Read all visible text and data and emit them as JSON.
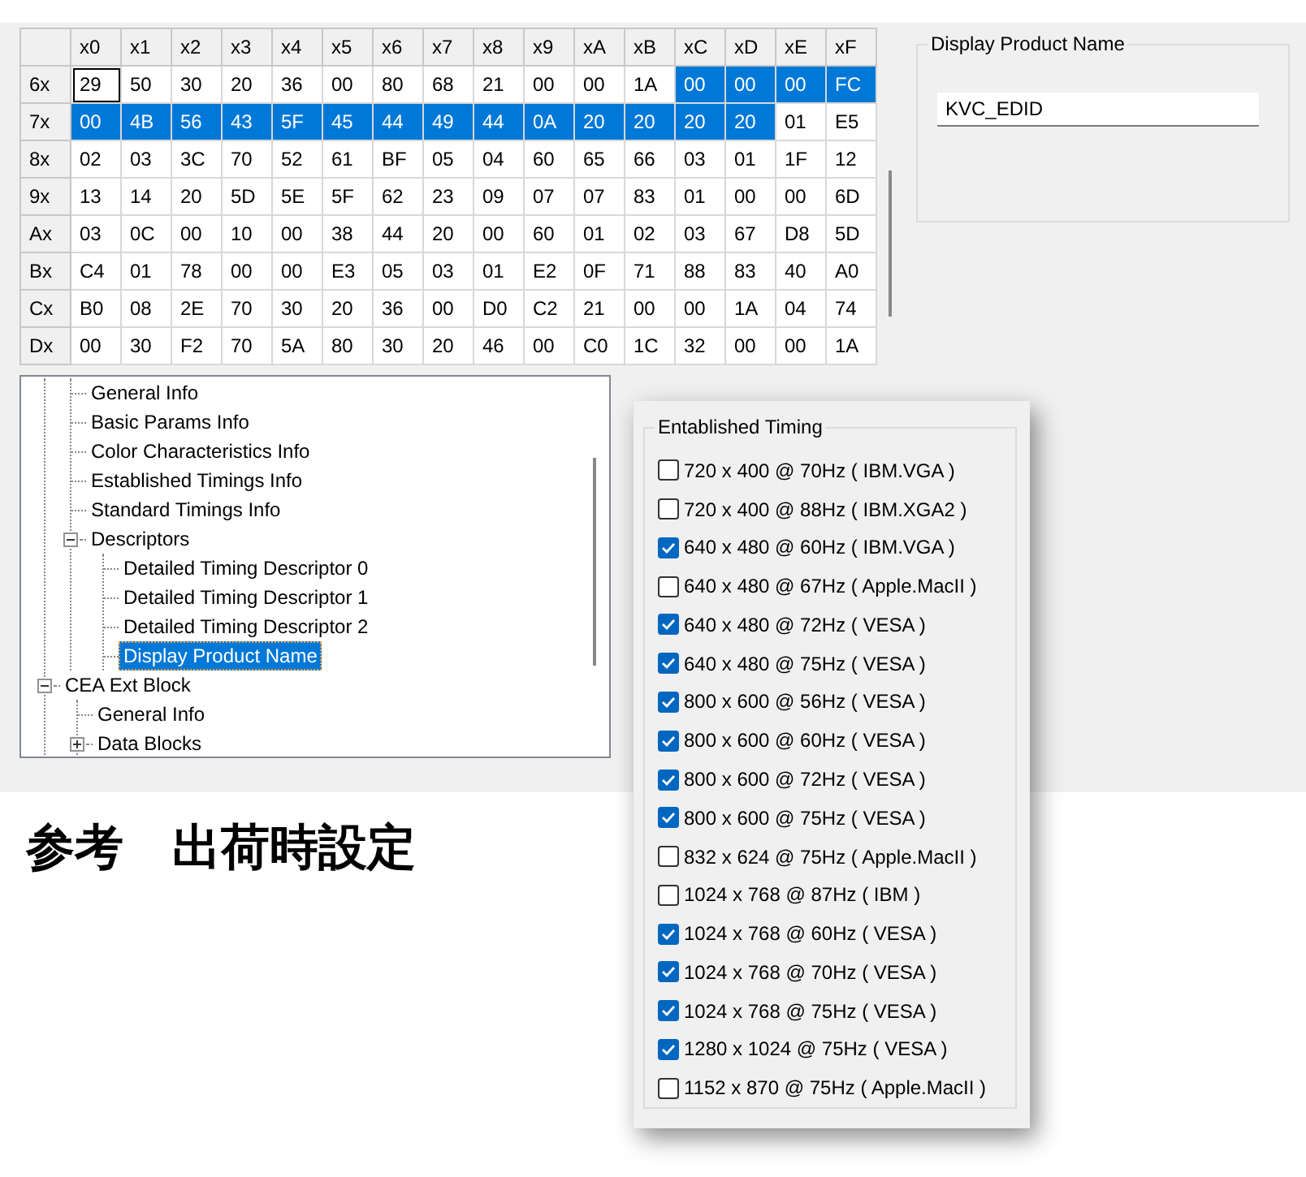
{
  "hex_table": {
    "columns": [
      "x0",
      "x1",
      "x2",
      "x3",
      "x4",
      "x5",
      "x6",
      "x7",
      "x8",
      "x9",
      "xA",
      "xB",
      "xC",
      "xD",
      "xE",
      "xF"
    ],
    "rows": [
      {
        "label": "6x",
        "cells": [
          {
            "text": "29",
            "selected": false,
            "focused": true
          },
          {
            "text": "50",
            "selected": false,
            "focused": false
          },
          {
            "text": "30",
            "selected": false,
            "focused": false
          },
          {
            "text": "20",
            "selected": false,
            "focused": false
          },
          {
            "text": "36",
            "selected": false,
            "focused": false
          },
          {
            "text": "00",
            "selected": false,
            "focused": false
          },
          {
            "text": "80",
            "selected": false,
            "focused": false
          },
          {
            "text": "68",
            "selected": false,
            "focused": false
          },
          {
            "text": "21",
            "selected": false,
            "focused": false
          },
          {
            "text": "00",
            "selected": false,
            "focused": false
          },
          {
            "text": "00",
            "selected": false,
            "focused": false
          },
          {
            "text": "1A",
            "selected": false,
            "focused": false
          },
          {
            "text": "00",
            "selected": true,
            "focused": false
          },
          {
            "text": "00",
            "selected": true,
            "focused": false
          },
          {
            "text": "00",
            "selected": true,
            "focused": false
          },
          {
            "text": "FC",
            "selected": true,
            "focused": false
          }
        ]
      },
      {
        "label": "7x",
        "cells": [
          {
            "text": "00",
            "selected": true,
            "focused": false
          },
          {
            "text": "4B",
            "selected": true,
            "focused": false
          },
          {
            "text": "56",
            "selected": true,
            "focused": false
          },
          {
            "text": "43",
            "selected": true,
            "focused": false
          },
          {
            "text": "5F",
            "selected": true,
            "focused": false
          },
          {
            "text": "45",
            "selected": true,
            "focused": false
          },
          {
            "text": "44",
            "selected": true,
            "focused": false
          },
          {
            "text": "49",
            "selected": true,
            "focused": false
          },
          {
            "text": "44",
            "selected": true,
            "focused": false
          },
          {
            "text": "0A",
            "selected": true,
            "focused": false
          },
          {
            "text": "20",
            "selected": true,
            "focused": false
          },
          {
            "text": "20",
            "selected": true,
            "focused": false
          },
          {
            "text": "20",
            "selected": true,
            "focused": false
          },
          {
            "text": "20",
            "selected": true,
            "focused": false
          },
          {
            "text": "01",
            "selected": false,
            "focused": false
          },
          {
            "text": "E5",
            "selected": false,
            "focused": false
          }
        ]
      },
      {
        "label": "8x",
        "cells": [
          {
            "text": "02",
            "selected": false,
            "focused": false
          },
          {
            "text": "03",
            "selected": false,
            "focused": false
          },
          {
            "text": "3C",
            "selected": false,
            "focused": false
          },
          {
            "text": "70",
            "selected": false,
            "focused": false
          },
          {
            "text": "52",
            "selected": false,
            "focused": false
          },
          {
            "text": "61",
            "selected": false,
            "focused": false
          },
          {
            "text": "BF",
            "selected": false,
            "focused": false
          },
          {
            "text": "05",
            "selected": false,
            "focused": false
          },
          {
            "text": "04",
            "selected": false,
            "focused": false
          },
          {
            "text": "60",
            "selected": false,
            "focused": false
          },
          {
            "text": "65",
            "selected": false,
            "focused": false
          },
          {
            "text": "66",
            "selected": false,
            "focused": false
          },
          {
            "text": "03",
            "selected": false,
            "focused": false
          },
          {
            "text": "01",
            "selected": false,
            "focused": false
          },
          {
            "text": "1F",
            "selected": false,
            "focused": false
          },
          {
            "text": "12",
            "selected": false,
            "focused": false
          }
        ]
      },
      {
        "label": "9x",
        "cells": [
          {
            "text": "13",
            "selected": false,
            "focused": false
          },
          {
            "text": "14",
            "selected": false,
            "focused": false
          },
          {
            "text": "20",
            "selected": false,
            "focused": false
          },
          {
            "text": "5D",
            "selected": false,
            "focused": false
          },
          {
            "text": "5E",
            "selected": false,
            "focused": false
          },
          {
            "text": "5F",
            "selected": false,
            "focused": false
          },
          {
            "text": "62",
            "selected": false,
            "focused": false
          },
          {
            "text": "23",
            "selected": false,
            "focused": false
          },
          {
            "text": "09",
            "selected": false,
            "focused": false
          },
          {
            "text": "07",
            "selected": false,
            "focused": false
          },
          {
            "text": "07",
            "selected": false,
            "focused": false
          },
          {
            "text": "83",
            "selected": false,
            "focused": false
          },
          {
            "text": "01",
            "selected": false,
            "focused": false
          },
          {
            "text": "00",
            "selected": false,
            "focused": false
          },
          {
            "text": "00",
            "selected": false,
            "focused": false
          },
          {
            "text": "6D",
            "selected": false,
            "focused": false
          }
        ]
      },
      {
        "label": "Ax",
        "cells": [
          {
            "text": "03",
            "selected": false,
            "focused": false
          },
          {
            "text": "0C",
            "selected": false,
            "focused": false
          },
          {
            "text": "00",
            "selected": false,
            "focused": false
          },
          {
            "text": "10",
            "selected": false,
            "focused": false
          },
          {
            "text": "00",
            "selected": false,
            "focused": false
          },
          {
            "text": "38",
            "selected": false,
            "focused": false
          },
          {
            "text": "44",
            "selected": false,
            "focused": false
          },
          {
            "text": "20",
            "selected": false,
            "focused": false
          },
          {
            "text": "00",
            "selected": false,
            "focused": false
          },
          {
            "text": "60",
            "selected": false,
            "focused": false
          },
          {
            "text": "01",
            "selected": false,
            "focused": false
          },
          {
            "text": "02",
            "selected": false,
            "focused": false
          },
          {
            "text": "03",
            "selected": false,
            "focused": false
          },
          {
            "text": "67",
            "selected": false,
            "focused": false
          },
          {
            "text": "D8",
            "selected": false,
            "focused": false
          },
          {
            "text": "5D",
            "selected": false,
            "focused": false
          }
        ]
      },
      {
        "label": "Bx",
        "cells": [
          {
            "text": "C4",
            "selected": false,
            "focused": false
          },
          {
            "text": "01",
            "selected": false,
            "focused": false
          },
          {
            "text": "78",
            "selected": false,
            "focused": false
          },
          {
            "text": "00",
            "selected": false,
            "focused": false
          },
          {
            "text": "00",
            "selected": false,
            "focused": false
          },
          {
            "text": "E3",
            "selected": false,
            "focused": false
          },
          {
            "text": "05",
            "selected": false,
            "focused": false
          },
          {
            "text": "03",
            "selected": false,
            "focused": false
          },
          {
            "text": "01",
            "selected": false,
            "focused": false
          },
          {
            "text": "E2",
            "selected": false,
            "focused": false
          },
          {
            "text": "0F",
            "selected": false,
            "focused": false
          },
          {
            "text": "71",
            "selected": false,
            "focused": false
          },
          {
            "text": "88",
            "selected": false,
            "focused": false
          },
          {
            "text": "83",
            "selected": false,
            "focused": false
          },
          {
            "text": "40",
            "selected": false,
            "focused": false
          },
          {
            "text": "A0",
            "selected": false,
            "focused": false
          }
        ]
      },
      {
        "label": "Cx",
        "cells": [
          {
            "text": "B0",
            "selected": false,
            "focused": false
          },
          {
            "text": "08",
            "selected": false,
            "focused": false
          },
          {
            "text": "2E",
            "selected": false,
            "focused": false
          },
          {
            "text": "70",
            "selected": false,
            "focused": false
          },
          {
            "text": "30",
            "selected": false,
            "focused": false
          },
          {
            "text": "20",
            "selected": false,
            "focused": false
          },
          {
            "text": "36",
            "selected": false,
            "focused": false
          },
          {
            "text": "00",
            "selected": false,
            "focused": false
          },
          {
            "text": "D0",
            "selected": false,
            "focused": false
          },
          {
            "text": "C2",
            "selected": false,
            "focused": false
          },
          {
            "text": "21",
            "selected": false,
            "focused": false
          },
          {
            "text": "00",
            "selected": false,
            "focused": false
          },
          {
            "text": "00",
            "selected": false,
            "focused": false
          },
          {
            "text": "1A",
            "selected": false,
            "focused": false
          },
          {
            "text": "04",
            "selected": false,
            "focused": false
          },
          {
            "text": "74",
            "selected": false,
            "focused": false
          }
        ]
      },
      {
        "label": "Dx",
        "cells": [
          {
            "text": "00",
            "selected": false,
            "focused": false
          },
          {
            "text": "30",
            "selected": false,
            "focused": false
          },
          {
            "text": "F2",
            "selected": false,
            "focused": false
          },
          {
            "text": "70",
            "selected": false,
            "focused": false
          },
          {
            "text": "5A",
            "selected": false,
            "focused": false
          },
          {
            "text": "80",
            "selected": false,
            "focused": false
          },
          {
            "text": "30",
            "selected": false,
            "focused": false
          },
          {
            "text": "20",
            "selected": false,
            "focused": false
          },
          {
            "text": "46",
            "selected": false,
            "focused": false
          },
          {
            "text": "00",
            "selected": false,
            "focused": false
          },
          {
            "text": "C0",
            "selected": false,
            "focused": false
          },
          {
            "text": "1C",
            "selected": false,
            "focused": false
          },
          {
            "text": "32",
            "selected": false,
            "focused": false
          },
          {
            "text": "00",
            "selected": false,
            "focused": false
          },
          {
            "text": "00",
            "selected": false,
            "focused": false
          },
          {
            "text": "1A",
            "selected": false,
            "focused": false
          }
        ]
      }
    ]
  },
  "product_name_group": {
    "title": "Display Product Name",
    "value": "KVC_EDID"
  },
  "tree": {
    "continued_items": [
      {
        "label": "General Info",
        "selected": false
      },
      {
        "label": "Basic Params Info",
        "selected": false
      },
      {
        "label": "Color Characteristics Info",
        "selected": false
      },
      {
        "label": "Established Timings Info",
        "selected": false
      },
      {
        "label": "Standard Timings Info",
        "selected": false
      },
      {
        "label": "Descriptors",
        "selected": false,
        "expanded": true,
        "children": [
          {
            "label": "Detailed Timing Descriptor 0",
            "selected": false
          },
          {
            "label": "Detailed Timing Descriptor 1",
            "selected": false
          },
          {
            "label": "Detailed Timing Descriptor 2",
            "selected": false
          },
          {
            "label": "Display Product Name",
            "selected": true
          }
        ]
      }
    ],
    "items": [
      {
        "label": "CEA Ext Block",
        "selected": false,
        "expanded": true,
        "children": [
          {
            "label": "General Info",
            "selected": false
          },
          {
            "label": "Data Blocks",
            "selected": false,
            "expanded": false
          }
        ]
      }
    ]
  },
  "caption": "参考　出荷時設定",
  "timing_popup": {
    "title": "Entablished Timing",
    "options": [
      {
        "label": "720 x 400 @ 70Hz ( IBM.VGA )",
        "checked": false
      },
      {
        "label": "720 x 400 @ 88Hz ( IBM.XGA2 )",
        "checked": false
      },
      {
        "label": "640 x 480 @ 60Hz ( IBM.VGA )",
        "checked": true
      },
      {
        "label": "640 x 480 @ 67Hz ( Apple.MacII )",
        "checked": false
      },
      {
        "label": "640 x 480 @ 72Hz ( VESA )",
        "checked": true
      },
      {
        "label": "640 x 480 @ 75Hz ( VESA )",
        "checked": true
      },
      {
        "label": "800 x 600 @ 56Hz ( VESA )",
        "checked": true
      },
      {
        "label": "800 x 600 @ 60Hz ( VESA )",
        "checked": true
      },
      {
        "label": "800 x 600 @ 72Hz ( VESA )",
        "checked": true
      },
      {
        "label": "800 x 600 @ 75Hz ( VESA )",
        "checked": true
      },
      {
        "label": "832 x 624 @ 75Hz ( Apple.MacII )",
        "checked": false
      },
      {
        "label": "1024 x 768 @ 87Hz ( IBM )",
        "checked": false
      },
      {
        "label": "1024 x 768 @ 60Hz ( VESA )",
        "checked": true
      },
      {
        "label": "1024 x 768 @ 70Hz ( VESA )",
        "checked": true
      },
      {
        "label": "1024 x 768 @ 75Hz ( VESA )",
        "checked": true
      },
      {
        "label": "1280 x 1024 @ 75Hz ( VESA )",
        "checked": true
      },
      {
        "label": "1152 x 870 @ 75Hz ( Apple.MacII )",
        "checked": false
      }
    ]
  }
}
